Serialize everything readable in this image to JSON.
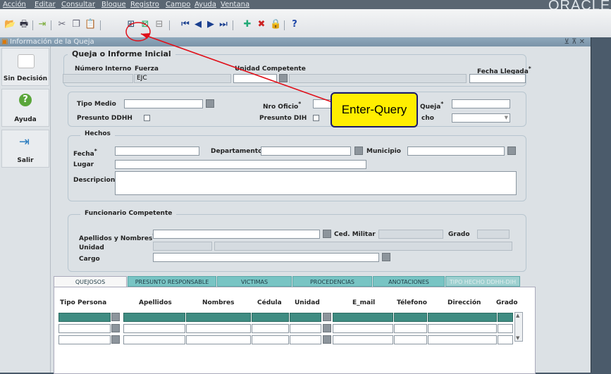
{
  "menu": [
    "Acción",
    "Editar",
    "Consultar",
    "Bloque",
    "Registro",
    "Campo",
    "Ayuda",
    "Ventana"
  ],
  "brand": "ORACLE",
  "toolbar_icons": [
    "open-folder-icon",
    "print-icon",
    "exit-icon",
    "cut-icon",
    "copy-icon",
    "paste-icon",
    "enter-query-icon",
    "execute-query-icon",
    "cancel-query-icon",
    "first-record-icon",
    "previous-record-icon",
    "next-record-icon",
    "last-record-icon",
    "insert-record-icon",
    "delete-record-icon",
    "lock-record-icon",
    "help-icon"
  ],
  "window": {
    "title": "Información de la Queja",
    "controls": "⊻ ⊼ ✕"
  },
  "sidebar": {
    "sin_decision": "Sin Decisión",
    "ayuda": "Ayuda",
    "salir": "Salir"
  },
  "queja": {
    "legend": "Queja o Informe Inicial",
    "numero_interno_label": "Número Interno",
    "fuerza_label": "Fuerza",
    "fuerza_value": "EJC",
    "unidad_competente_label": "Unidad Competente",
    "fecha_llegada_label": "Fecha Llegada",
    "required_mark": "*"
  },
  "medio": {
    "tipo_medio_label": "Tipo Medio",
    "nro_oficio_label": "Nro Oficio",
    "queja_label": "Queja",
    "presunto_ddhh_label": "Presunto DDHH",
    "presunto_dih_label": "Presunto DIH",
    "hecho_label": "cho"
  },
  "hechos": {
    "legend": "Hechos",
    "fecha_label": "Fecha",
    "departamento_label": "Departamento",
    "municipio_label": "Municipio",
    "lugar_label": "Lugar",
    "descripcion_label": "Descripcion"
  },
  "funcionario": {
    "legend": "Funcionario Competente",
    "apellidos_nombres_label": "Apellidos y Nombres",
    "ced_militar_label": "Ced. Militar",
    "grado_label": "Grado",
    "unidad_label": "Unidad",
    "cargo_label": "Cargo"
  },
  "tabs": [
    "QUEJOSOS",
    "PRESUNTO RESPONSABLE",
    "VICTIMAS",
    "PROCEDENCIAS",
    "ANOTACIONES",
    "TIPO HECHO DDHH-DIH"
  ],
  "quejosos_columns": [
    "Tipo Persona",
    "Apellidos",
    "Nombres",
    "Cédula",
    "Unidad",
    "E_mail",
    "Télefono",
    "Dirección",
    "Grado"
  ],
  "callout": "Enter-Query",
  "colors": {
    "callout_bg": "#ffee00",
    "arrow": "#e0101a",
    "current_row": "#3f8c82",
    "tab": "#78c4c4"
  }
}
